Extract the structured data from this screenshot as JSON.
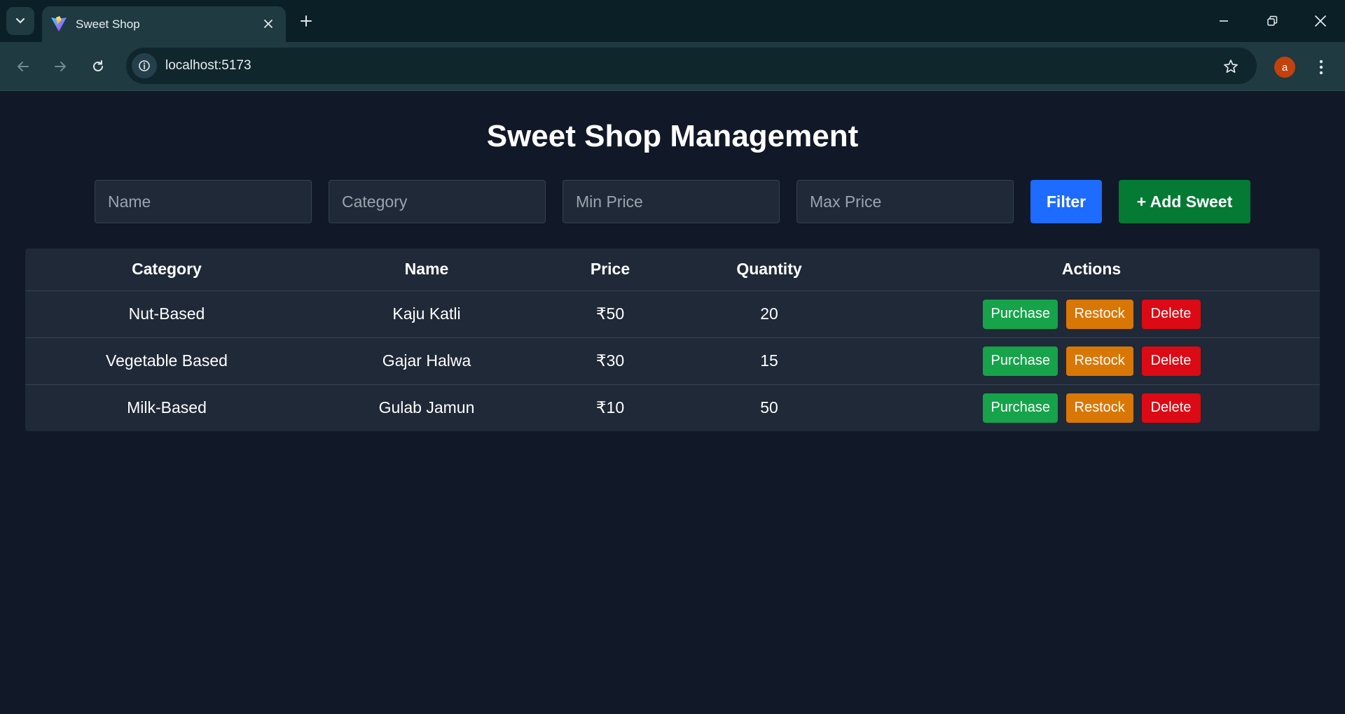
{
  "browser": {
    "tab_title": "Sweet Shop",
    "url": "localhost:5173",
    "profile_initial": "a",
    "icons": {
      "tab_list": "chevron-down-icon",
      "favicon": "vite-logo-icon",
      "tab_close": "close-icon",
      "new_tab": "plus-icon",
      "minimize": "minimize-icon",
      "restore": "restore-icon",
      "close_window": "close-icon",
      "back": "arrow-left-icon",
      "forward": "arrow-right-icon",
      "reload": "reload-icon",
      "site_info": "info-icon",
      "bookmark": "star-icon",
      "menu": "kebab-menu-icon"
    }
  },
  "page": {
    "title": "Sweet Shop Management"
  },
  "filters": {
    "name_placeholder": "Name",
    "category_placeholder": "Category",
    "min_price_placeholder": "Min Price",
    "max_price_placeholder": "Max Price",
    "filter_label": "Filter",
    "add_label": "+ Add Sweet"
  },
  "table": {
    "headers": {
      "category": "Category",
      "name": "Name",
      "price": "Price",
      "quantity": "Quantity",
      "actions": "Actions"
    },
    "rows": [
      {
        "category": "Nut-Based",
        "name": "Kaju Katli",
        "price": "₹50",
        "quantity": "20"
      },
      {
        "category": "Vegetable Based",
        "name": "Gajar Halwa",
        "price": "₹30",
        "quantity": "15"
      },
      {
        "category": "Milk-Based",
        "name": "Gulab Jamun",
        "price": "₹10",
        "quantity": "50"
      }
    ],
    "actions": {
      "purchase": "Purchase",
      "restock": "Restock",
      "delete": "Delete"
    }
  },
  "colors": {
    "background": "#111827",
    "panel": "#1f2937",
    "filter_button": "#1d6bff",
    "add_button": "#047a34",
    "purchase": "#16a34a",
    "restock": "#d97706",
    "delete": "#dc0a14"
  }
}
